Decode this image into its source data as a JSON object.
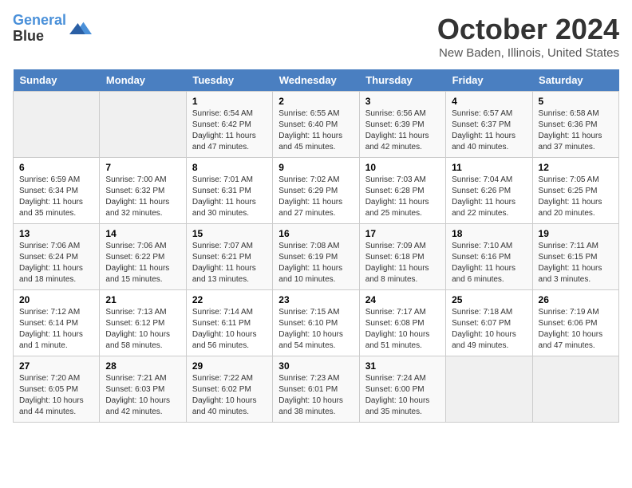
{
  "header": {
    "logo_line1": "General",
    "logo_line2": "Blue",
    "month": "October 2024",
    "location": "New Baden, Illinois, United States"
  },
  "weekdays": [
    "Sunday",
    "Monday",
    "Tuesday",
    "Wednesday",
    "Thursday",
    "Friday",
    "Saturday"
  ],
  "weeks": [
    [
      {
        "day": "",
        "info": ""
      },
      {
        "day": "",
        "info": ""
      },
      {
        "day": "1",
        "info": "Sunrise: 6:54 AM\nSunset: 6:42 PM\nDaylight: 11 hours and 47 minutes."
      },
      {
        "day": "2",
        "info": "Sunrise: 6:55 AM\nSunset: 6:40 PM\nDaylight: 11 hours and 45 minutes."
      },
      {
        "day": "3",
        "info": "Sunrise: 6:56 AM\nSunset: 6:39 PM\nDaylight: 11 hours and 42 minutes."
      },
      {
        "day": "4",
        "info": "Sunrise: 6:57 AM\nSunset: 6:37 PM\nDaylight: 11 hours and 40 minutes."
      },
      {
        "day": "5",
        "info": "Sunrise: 6:58 AM\nSunset: 6:36 PM\nDaylight: 11 hours and 37 minutes."
      }
    ],
    [
      {
        "day": "6",
        "info": "Sunrise: 6:59 AM\nSunset: 6:34 PM\nDaylight: 11 hours and 35 minutes."
      },
      {
        "day": "7",
        "info": "Sunrise: 7:00 AM\nSunset: 6:32 PM\nDaylight: 11 hours and 32 minutes."
      },
      {
        "day": "8",
        "info": "Sunrise: 7:01 AM\nSunset: 6:31 PM\nDaylight: 11 hours and 30 minutes."
      },
      {
        "day": "9",
        "info": "Sunrise: 7:02 AM\nSunset: 6:29 PM\nDaylight: 11 hours and 27 minutes."
      },
      {
        "day": "10",
        "info": "Sunrise: 7:03 AM\nSunset: 6:28 PM\nDaylight: 11 hours and 25 minutes."
      },
      {
        "day": "11",
        "info": "Sunrise: 7:04 AM\nSunset: 6:26 PM\nDaylight: 11 hours and 22 minutes."
      },
      {
        "day": "12",
        "info": "Sunrise: 7:05 AM\nSunset: 6:25 PM\nDaylight: 11 hours and 20 minutes."
      }
    ],
    [
      {
        "day": "13",
        "info": "Sunrise: 7:06 AM\nSunset: 6:24 PM\nDaylight: 11 hours and 18 minutes."
      },
      {
        "day": "14",
        "info": "Sunrise: 7:06 AM\nSunset: 6:22 PM\nDaylight: 11 hours and 15 minutes."
      },
      {
        "day": "15",
        "info": "Sunrise: 7:07 AM\nSunset: 6:21 PM\nDaylight: 11 hours and 13 minutes."
      },
      {
        "day": "16",
        "info": "Sunrise: 7:08 AM\nSunset: 6:19 PM\nDaylight: 11 hours and 10 minutes."
      },
      {
        "day": "17",
        "info": "Sunrise: 7:09 AM\nSunset: 6:18 PM\nDaylight: 11 hours and 8 minutes."
      },
      {
        "day": "18",
        "info": "Sunrise: 7:10 AM\nSunset: 6:16 PM\nDaylight: 11 hours and 6 minutes."
      },
      {
        "day": "19",
        "info": "Sunrise: 7:11 AM\nSunset: 6:15 PM\nDaylight: 11 hours and 3 minutes."
      }
    ],
    [
      {
        "day": "20",
        "info": "Sunrise: 7:12 AM\nSunset: 6:14 PM\nDaylight: 11 hours and 1 minute."
      },
      {
        "day": "21",
        "info": "Sunrise: 7:13 AM\nSunset: 6:12 PM\nDaylight: 10 hours and 58 minutes."
      },
      {
        "day": "22",
        "info": "Sunrise: 7:14 AM\nSunset: 6:11 PM\nDaylight: 10 hours and 56 minutes."
      },
      {
        "day": "23",
        "info": "Sunrise: 7:15 AM\nSunset: 6:10 PM\nDaylight: 10 hours and 54 minutes."
      },
      {
        "day": "24",
        "info": "Sunrise: 7:17 AM\nSunset: 6:08 PM\nDaylight: 10 hours and 51 minutes."
      },
      {
        "day": "25",
        "info": "Sunrise: 7:18 AM\nSunset: 6:07 PM\nDaylight: 10 hours and 49 minutes."
      },
      {
        "day": "26",
        "info": "Sunrise: 7:19 AM\nSunset: 6:06 PM\nDaylight: 10 hours and 47 minutes."
      }
    ],
    [
      {
        "day": "27",
        "info": "Sunrise: 7:20 AM\nSunset: 6:05 PM\nDaylight: 10 hours and 44 minutes."
      },
      {
        "day": "28",
        "info": "Sunrise: 7:21 AM\nSunset: 6:03 PM\nDaylight: 10 hours and 42 minutes."
      },
      {
        "day": "29",
        "info": "Sunrise: 7:22 AM\nSunset: 6:02 PM\nDaylight: 10 hours and 40 minutes."
      },
      {
        "day": "30",
        "info": "Sunrise: 7:23 AM\nSunset: 6:01 PM\nDaylight: 10 hours and 38 minutes."
      },
      {
        "day": "31",
        "info": "Sunrise: 7:24 AM\nSunset: 6:00 PM\nDaylight: 10 hours and 35 minutes."
      },
      {
        "day": "",
        "info": ""
      },
      {
        "day": "",
        "info": ""
      }
    ]
  ]
}
